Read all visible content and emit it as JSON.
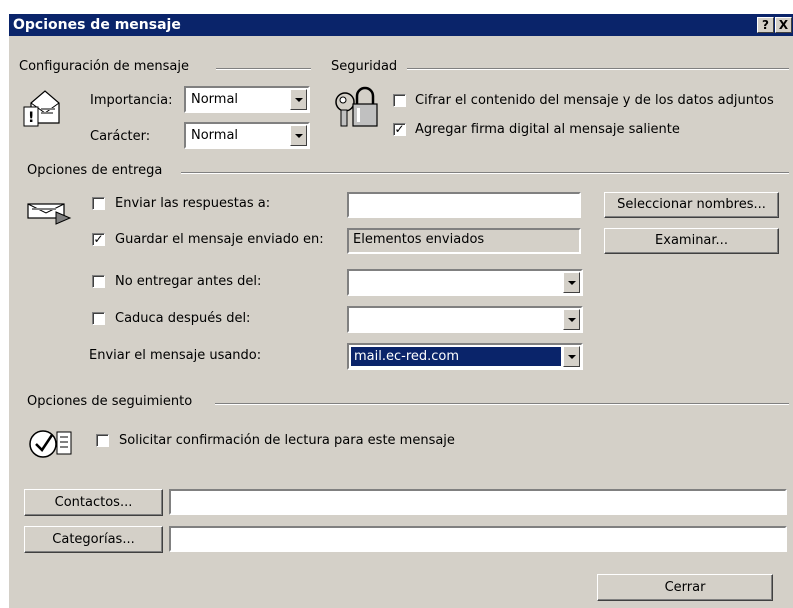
{
  "window": {
    "title": "Opciones de mensaje",
    "help_label": "?",
    "close_label": "X"
  },
  "config": {
    "section": "Configuración de mensaje",
    "importance_label": "Importancia:",
    "importance_value": "Normal",
    "sensitivity_label": "Carácter:",
    "sensitivity_value": "Normal"
  },
  "security": {
    "section": "Seguridad",
    "encrypt_label": "Cifrar el contenido del mensaje y de los datos adjuntos",
    "encrypt_checked": false,
    "sign_label": "Agregar firma digital al mensaje saliente",
    "sign_checked": true
  },
  "delivery": {
    "section": "Opciones de entrega",
    "reply_label": "Enviar las respuestas a:",
    "reply_checked": false,
    "reply_value": "",
    "save_label": "Guardar el mensaje enviado en:",
    "save_checked": true,
    "save_value": "Elementos enviados",
    "not_before_label": "No entregar antes del:",
    "not_before_checked": false,
    "not_before_value": "",
    "expires_label": "Caduca después del:",
    "expires_checked": false,
    "expires_value": "",
    "send_using_label": "Enviar el mensaje usando:",
    "send_using_value": "mail.ec-red.com",
    "select_names_button": "Seleccionar nombres...",
    "browse_button": "Examinar..."
  },
  "tracking": {
    "section": "Opciones de seguimiento",
    "read_receipt_label": "Solicitar confirmación de lectura para este mensaje",
    "read_receipt_checked": false
  },
  "bottom": {
    "contacts_button": "Contactos...",
    "contacts_value": "",
    "categories_button": "Categorías...",
    "categories_value": "",
    "close_button": "Cerrar"
  }
}
